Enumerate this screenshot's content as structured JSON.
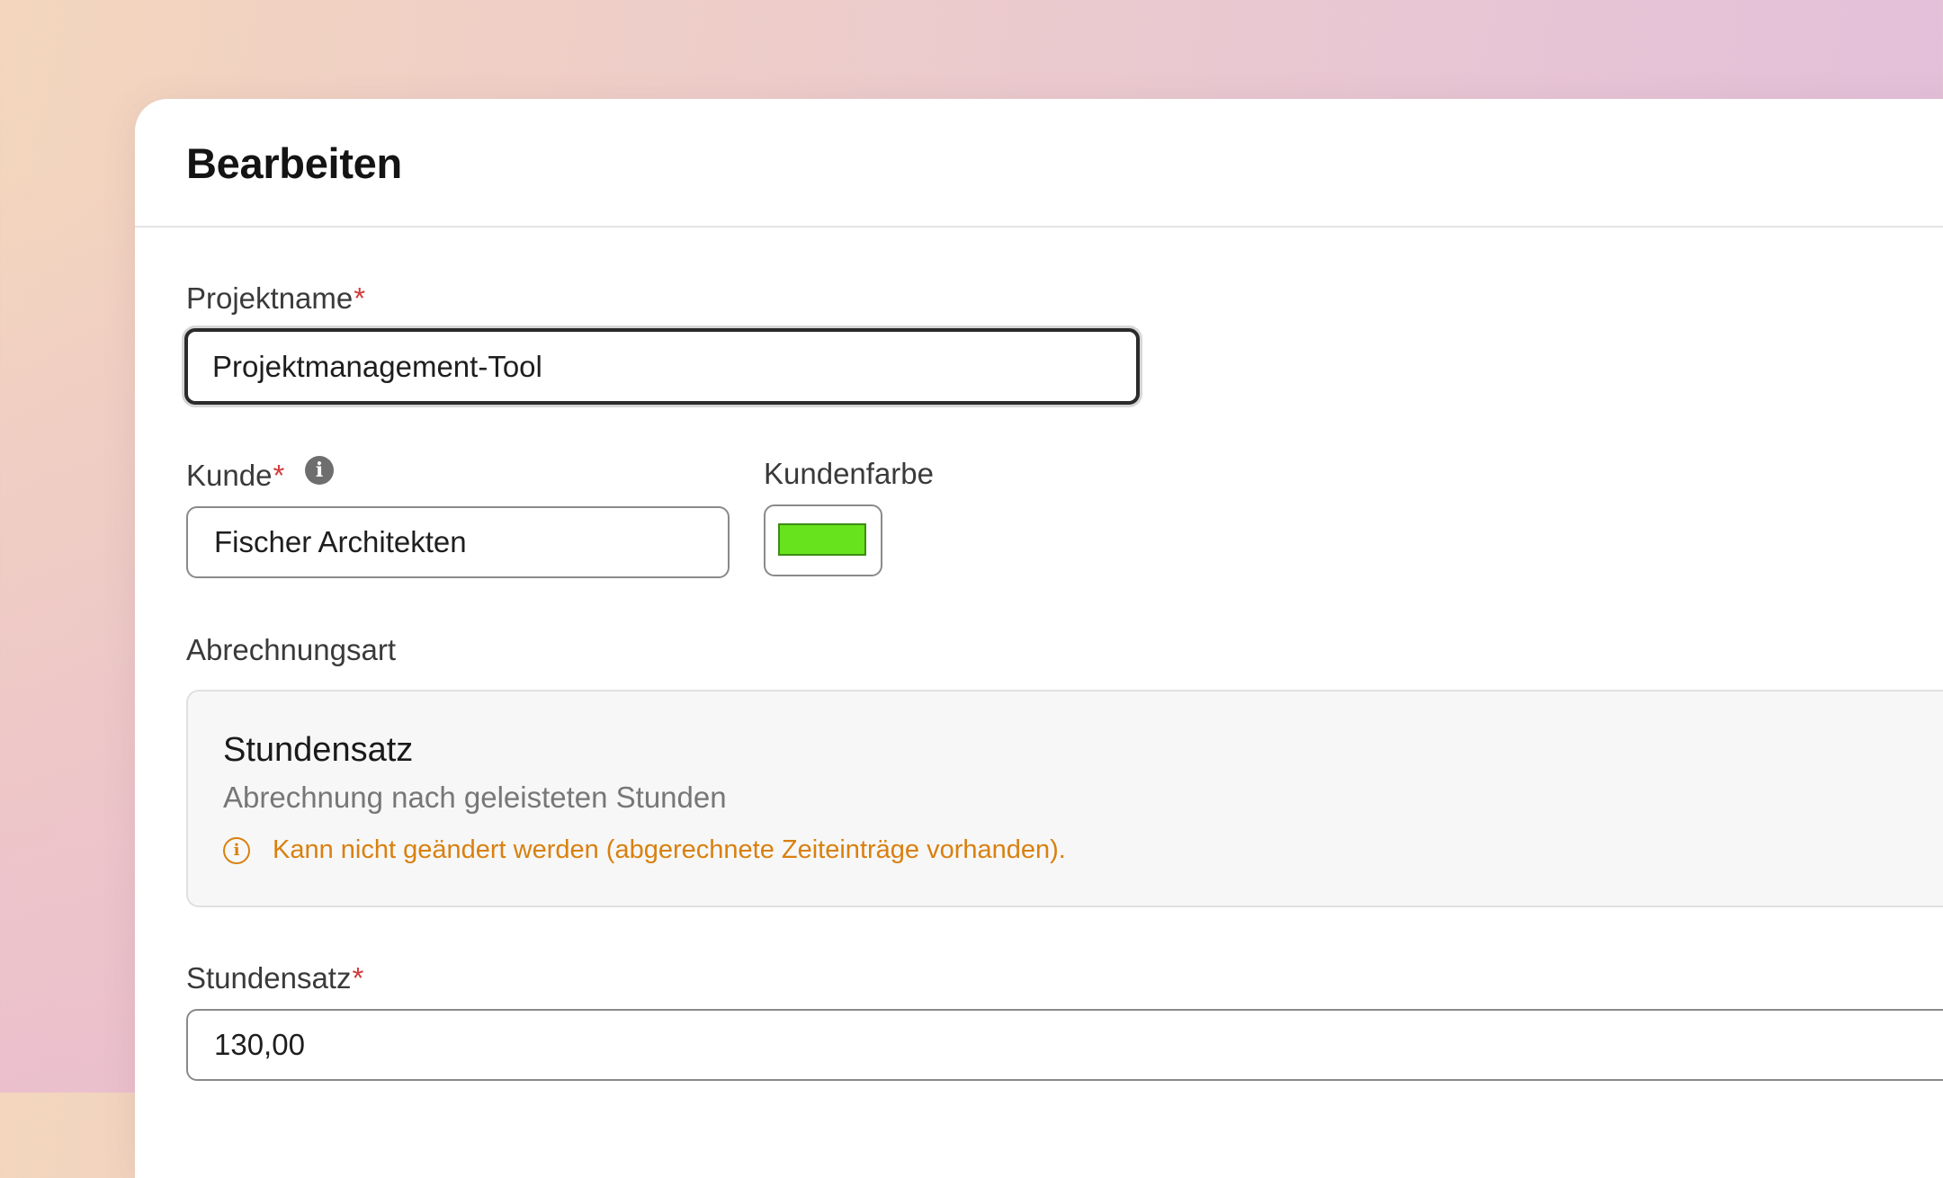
{
  "dialog": {
    "title": "Bearbeiten"
  },
  "form": {
    "project_name": {
      "label": "Projektname",
      "required_mark": "*",
      "value": "Projektmanagement-Tool"
    },
    "customer": {
      "label": "Kunde",
      "required_mark": "*",
      "value": "Fischer Architekten",
      "info_icon": "info-icon"
    },
    "customer_color": {
      "label": "Kundenfarbe",
      "value": "#66e31c"
    },
    "billing": {
      "label": "Abrechnungsart",
      "selected_title": "Stundensatz",
      "selected_description": "Abrechnung nach geleisteten Stunden",
      "warning": "Kann nicht geändert werden (abgerechnete Zeiteinträge vorhanden).",
      "warning_icon": "info-outline-icon",
      "warning_color": "#d9800f"
    },
    "hourly_rate": {
      "label": "Stundensatz",
      "required_mark": "*",
      "value": "130,00"
    }
  }
}
